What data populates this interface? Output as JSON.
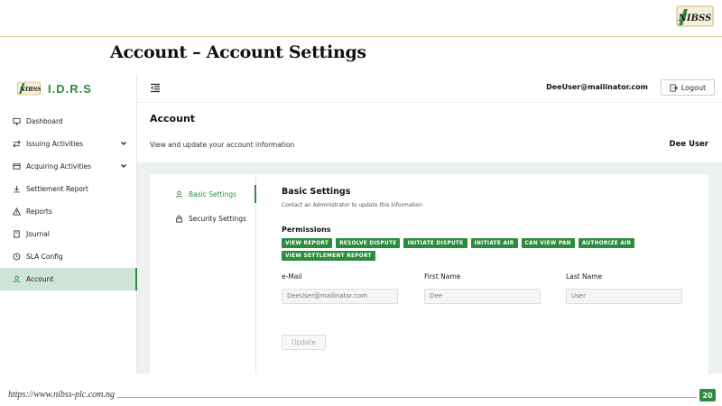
{
  "slide": {
    "title": "Account – Account Settings",
    "footer_url": "https://www.nibss-plc.com.ng",
    "page_number": "20",
    "logo_text": "NIBSS"
  },
  "app": {
    "brand": "I.D.R.S",
    "user_email": "DeeUser@mailinator.com",
    "logout_label": "Logout",
    "sidebar": {
      "items": [
        {
          "label": "Dashboard",
          "icon": "monitor-icon"
        },
        {
          "label": "Issuing Activities",
          "icon": "transfer-icon",
          "expandable": true
        },
        {
          "label": "Acquiring Activities",
          "icon": "card-icon",
          "expandable": true
        },
        {
          "label": "Settlement Report",
          "icon": "download-icon"
        },
        {
          "label": "Reports",
          "icon": "warning-icon"
        },
        {
          "label": "Journal",
          "icon": "document-icon"
        },
        {
          "label": "SLA Config",
          "icon": "clock-icon"
        },
        {
          "label": "Account",
          "icon": "user-icon",
          "active": true
        }
      ]
    },
    "header": {
      "title": "Account",
      "subtitle": "View and update your account information",
      "user_name": "Dee User"
    },
    "card_nav": [
      {
        "label": "Basic Settings",
        "icon": "user-icon",
        "active": true
      },
      {
        "label": "Security Settings",
        "icon": "lock-icon"
      }
    ],
    "basic_settings": {
      "title": "Basic Settings",
      "note": "Contact an Administrator to update this information",
      "permissions_label": "Permissions",
      "permissions": [
        "VIEW REPORT",
        "RESOLVE DISPUTE",
        "INITIATE DISPUTE",
        "INITIATE AIR",
        "CAN VIEW PAN",
        "AUTHORIZE AIR",
        "VIEW SETTLEMENT REPORT"
      ],
      "fields": [
        {
          "label": "e-Mail",
          "placeholder": "DeeUser@mailinator.com"
        },
        {
          "label": "First Name",
          "placeholder": "Dee"
        },
        {
          "label": "Last Name",
          "placeholder": "User"
        }
      ],
      "update_label": "Update"
    }
  },
  "colors": {
    "accent": "#2e8b3e",
    "active_bg": "#cfe3d6",
    "content_bg": "#eaf1ee"
  }
}
